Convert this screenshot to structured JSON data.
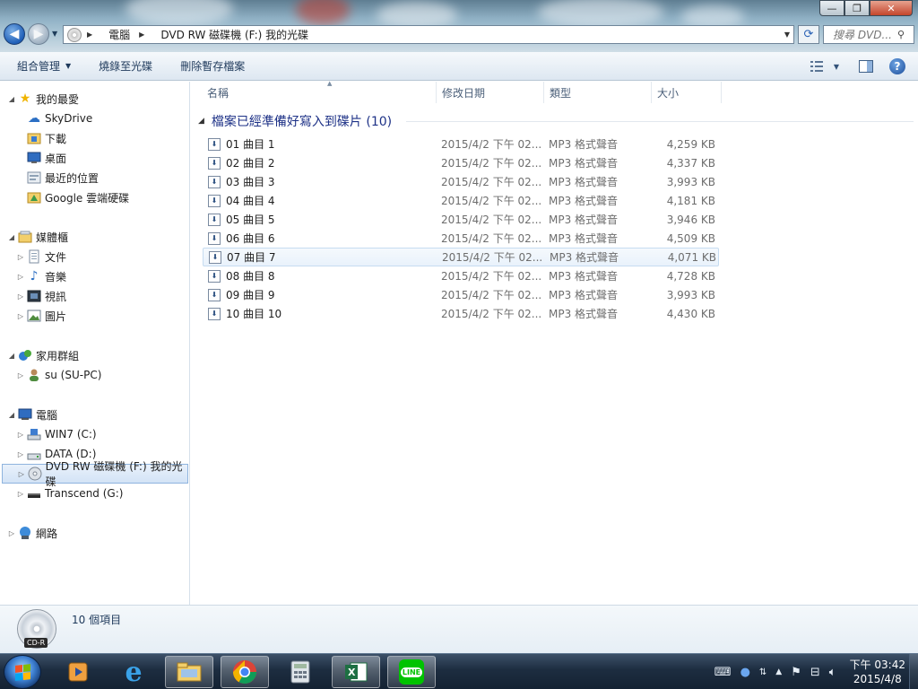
{
  "window": {
    "controls": {
      "minimize": "—",
      "maximize": "❐",
      "close": "✕"
    }
  },
  "address": {
    "segments": [
      "電腦",
      "DVD RW 磁碟機 (F:) 我的光碟"
    ],
    "search_placeholder": "搜尋 DVD..."
  },
  "toolbar": {
    "organize": "組合管理",
    "burn": "燒錄至光碟",
    "delete_temp": "刪除暫存檔案"
  },
  "nav": {
    "favorites": {
      "label": "我的最愛",
      "items": [
        "SkyDrive",
        "下載",
        "桌面",
        "最近的位置",
        "Google 雲端硬碟"
      ]
    },
    "libraries": {
      "label": "媒體櫃",
      "items": [
        "文件",
        "音樂",
        "視訊",
        "圖片"
      ]
    },
    "homegroup": {
      "label": "家用群組",
      "items": [
        "su (SU-PC)"
      ]
    },
    "computer": {
      "label": "電腦",
      "items": [
        "WIN7 (C:)",
        "DATA (D:)",
        "DVD RW 磁碟機 (F:) 我的光碟",
        "Transcend (G:)"
      ]
    },
    "network": {
      "label": "網路"
    }
  },
  "columns": {
    "name": "名稱",
    "date": "修改日期",
    "type": "類型",
    "size": "大小"
  },
  "group": {
    "title": "檔案已經準備好寫入到碟片 (10)"
  },
  "files": [
    {
      "name": "01 曲目 1",
      "date": "2015/4/2 下午 02...",
      "type": "MP3 格式聲音",
      "size": "4,259 KB"
    },
    {
      "name": "02 曲目 2",
      "date": "2015/4/2 下午 02...",
      "type": "MP3 格式聲音",
      "size": "4,337 KB"
    },
    {
      "name": "03 曲目 3",
      "date": "2015/4/2 下午 02...",
      "type": "MP3 格式聲音",
      "size": "3,993 KB"
    },
    {
      "name": "04 曲目 4",
      "date": "2015/4/2 下午 02...",
      "type": "MP3 格式聲音",
      "size": "4,181 KB"
    },
    {
      "name": "05 曲目 5",
      "date": "2015/4/2 下午 02...",
      "type": "MP3 格式聲音",
      "size": "3,946 KB"
    },
    {
      "name": "06 曲目 6",
      "date": "2015/4/2 下午 02...",
      "type": "MP3 格式聲音",
      "size": "4,509 KB"
    },
    {
      "name": "07 曲目 7",
      "date": "2015/4/2 下午 02...",
      "type": "MP3 格式聲音",
      "size": "4,071 KB"
    },
    {
      "name": "08 曲目 8",
      "date": "2015/4/2 下午 02...",
      "type": "MP3 格式聲音",
      "size": "4,728 KB"
    },
    {
      "name": "09 曲目 9",
      "date": "2015/4/2 下午 02...",
      "type": "MP3 格式聲音",
      "size": "3,993 KB"
    },
    {
      "name": "10 曲目 10",
      "date": "2015/4/2 下午 02...",
      "type": "MP3 格式聲音",
      "size": "4,430 KB"
    }
  ],
  "details": {
    "count": "10 個項目",
    "disc_label": "CD-R"
  },
  "taskbar": {
    "clock_time": "下午 03:42",
    "clock_date": "2015/4/8",
    "line_label": "LINE"
  },
  "colors": {
    "accent": "#1e3287",
    "toolbar_text": "#1e395b",
    "selection": "#d3e3f6"
  }
}
